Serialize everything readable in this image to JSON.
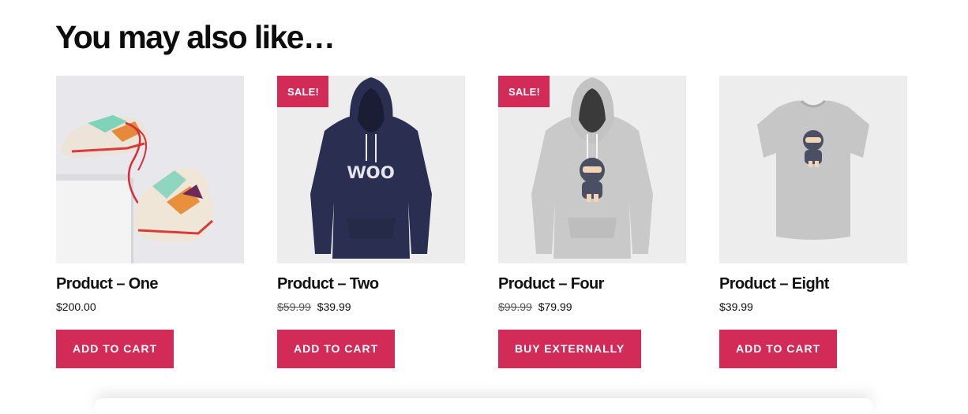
{
  "section": {
    "title": "You may also like…"
  },
  "products": [
    {
      "name": "Product – One",
      "price": "$200.00",
      "old_price": "",
      "sale": "",
      "button": "ADD TO CART",
      "image": "sneakers-image"
    },
    {
      "name": "Product – Two",
      "price": "$39.99",
      "old_price": "$59.99",
      "sale": "SALE!",
      "button": "ADD TO CART",
      "image": "navy-hoodie-image",
      "print": "woo"
    },
    {
      "name": "Product – Four",
      "price": "$79.99",
      "old_price": "$99.99",
      "sale": "SALE!",
      "button": "BUY EXTERNALLY",
      "image": "grey-ninja-hoodie-image"
    },
    {
      "name": "Product – Eight",
      "price": "$39.99",
      "old_price": "",
      "sale": "",
      "button": "ADD TO CART",
      "image": "ninja-tshirt-image"
    }
  ],
  "colors": {
    "accent": "#d22b58",
    "hoodie_navy": "#2a2f52",
    "hoodie_grey": "#c9c9c9"
  }
}
